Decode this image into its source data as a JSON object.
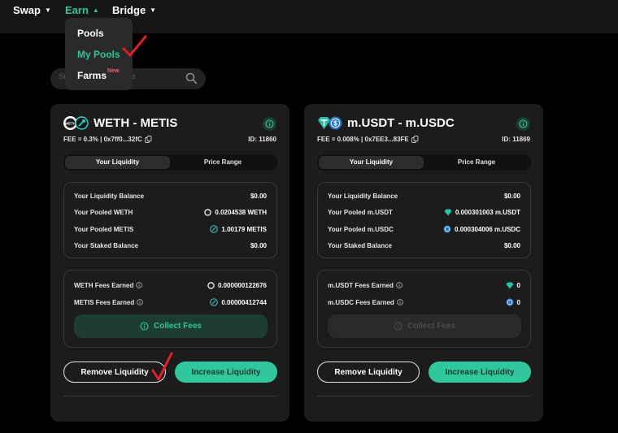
{
  "nav": {
    "swap": "Swap",
    "earn": "Earn",
    "bridge": "Bridge",
    "dropdown": {
      "pools": "Pools",
      "my_pools": "My Pools",
      "farms": "Farms",
      "farms_badge": "New"
    }
  },
  "search": {
    "placeholder": "Search by pool address"
  },
  "colors": {
    "accent": "#2fc79b",
    "card": "#1c1c1c",
    "annotation_check": "#e0202a"
  },
  "cards": [
    {
      "pair": "WETH - METIS",
      "icons": [
        "weth-icon",
        "metis-icon"
      ],
      "fee": "FEE = 0.3% | 0x7ff0...32fC",
      "id_label": "ID:",
      "id": "11860",
      "tabs": [
        "Your Liquidity",
        "Price Range"
      ],
      "balances": [
        {
          "label": "Your Liquidity Balance",
          "value": "$0.00"
        },
        {
          "label": "Your Pooled WETH",
          "value": "0.0204538 WETH",
          "icon": "weth-icon"
        },
        {
          "label": "Your Pooled METIS",
          "value": "1.00179 METIS",
          "icon": "metis-icon"
        },
        {
          "label": "Your Staked Balance",
          "value": "$0.00"
        }
      ],
      "fees": [
        {
          "label": "WETH Fees Earned",
          "value": "0.000000122676",
          "icon": "weth-icon"
        },
        {
          "label": "METIS Fees Earned",
          "value": "0.00000412744",
          "icon": "metis-icon"
        }
      ],
      "collect_label": "Collect Fees",
      "collect_enabled": true,
      "remove_label": "Remove Liquidity",
      "increase_label": "Increase Liquidity"
    },
    {
      "pair": "m.USDT - m.USDC",
      "icons": [
        "usdt-icon",
        "usdc-icon"
      ],
      "fee": "FEE = 0.008% | 0x7EE3...83FE",
      "id_label": "ID:",
      "id": "11869",
      "tabs": [
        "Your Liquidity",
        "Price Range"
      ],
      "balances": [
        {
          "label": "Your Liquidity Balance",
          "value": "$0.00"
        },
        {
          "label": "Your Pooled m.USDT",
          "value": "0.000301003 m.USDT",
          "icon": "usdt-icon"
        },
        {
          "label": "Your Pooled m.USDC",
          "value": "0.000304006 m.USDC",
          "icon": "usdc-icon"
        },
        {
          "label": "Your Staked Balance",
          "value": "$0.00"
        }
      ],
      "fees": [
        {
          "label": "m.USDT Fees Earned",
          "value": "0",
          "icon": "usdt-icon"
        },
        {
          "label": "m.USDC Fees Earned",
          "value": "0",
          "icon": "usdc-icon"
        }
      ],
      "collect_label": "Collect Fees",
      "collect_enabled": false,
      "remove_label": "Remove Liquidity",
      "increase_label": "Increase Liquidity"
    }
  ]
}
